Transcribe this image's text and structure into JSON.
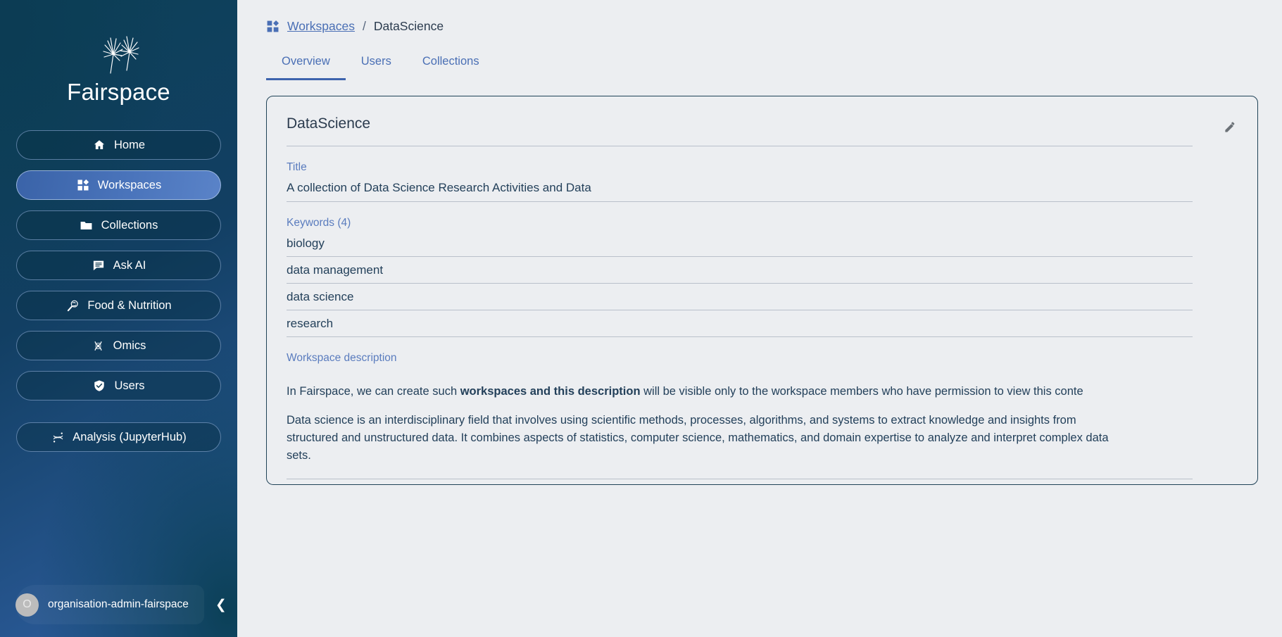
{
  "brand": {
    "name": "Fairspace",
    "logo_icon": "dandelion-seeds-icon"
  },
  "sidebar": {
    "items": [
      {
        "label": "Home",
        "icon": "home-icon",
        "active": false
      },
      {
        "label": "Workspaces",
        "icon": "workspaces-grid-icon",
        "active": true
      },
      {
        "label": "Collections",
        "icon": "folder-icon",
        "active": false
      },
      {
        "label": "Ask AI",
        "icon": "chat-bubble-icon",
        "active": false
      },
      {
        "label": "Food & Nutrition",
        "icon": "magnifier-food-icon",
        "active": false
      },
      {
        "label": "Omics",
        "icon": "dna-helix-icon",
        "active": false
      },
      {
        "label": "Users",
        "icon": "shield-check-icon",
        "active": false
      }
    ],
    "analysis": {
      "label": "Analysis (JupyterHub)",
      "icon": "jupyter-icon"
    },
    "user": {
      "avatar_initial": "O",
      "name": "organisation-admin-fairspace",
      "collapse_icon": "chevron-left-icon"
    }
  },
  "breadcrumb": {
    "icon": "workspaces-grid-icon",
    "parent": "Workspaces",
    "separator": "/",
    "current": "DataScience"
  },
  "tabs": [
    {
      "label": "Overview",
      "active": true
    },
    {
      "label": "Users",
      "active": false
    },
    {
      "label": "Collections",
      "active": false
    }
  ],
  "card": {
    "title": "DataScience",
    "edit_icon": "pencil-icon",
    "title_field": {
      "label": "Title",
      "value": "A collection of Data Science Research Activities and Data"
    },
    "keywords_field": {
      "label": "Keywords (4)",
      "values": [
        "biology",
        "data management",
        "data science",
        "research"
      ]
    },
    "description_field": {
      "label": "Workspace description",
      "paragraph1_pre": "In Fairspace, we can create such ",
      "paragraph1_bold": "workspaces and this description",
      "paragraph1_post": " will be visible only to the workspace members who have permission to view this conte",
      "paragraph2": "Data science is an interdisciplinary field that involves using scientific methods, processes, algorithms, and systems to extract knowledge and insights from structured and unstructured data. It combines aspects of statistics, computer science, mathematics, and domain expertise to analyze and interpret complex data sets."
    }
  },
  "colors": {
    "sidebar_dark": "#0c4057",
    "sidebar_blue": "#2f5fa2",
    "accent_blue": "#4a6fb5",
    "tab_active": "#3d63ad",
    "page_bg": "#eceef1",
    "card_border": "#1f4257",
    "text_dark": "#23405a",
    "label_blue": "#5a7cbe"
  }
}
